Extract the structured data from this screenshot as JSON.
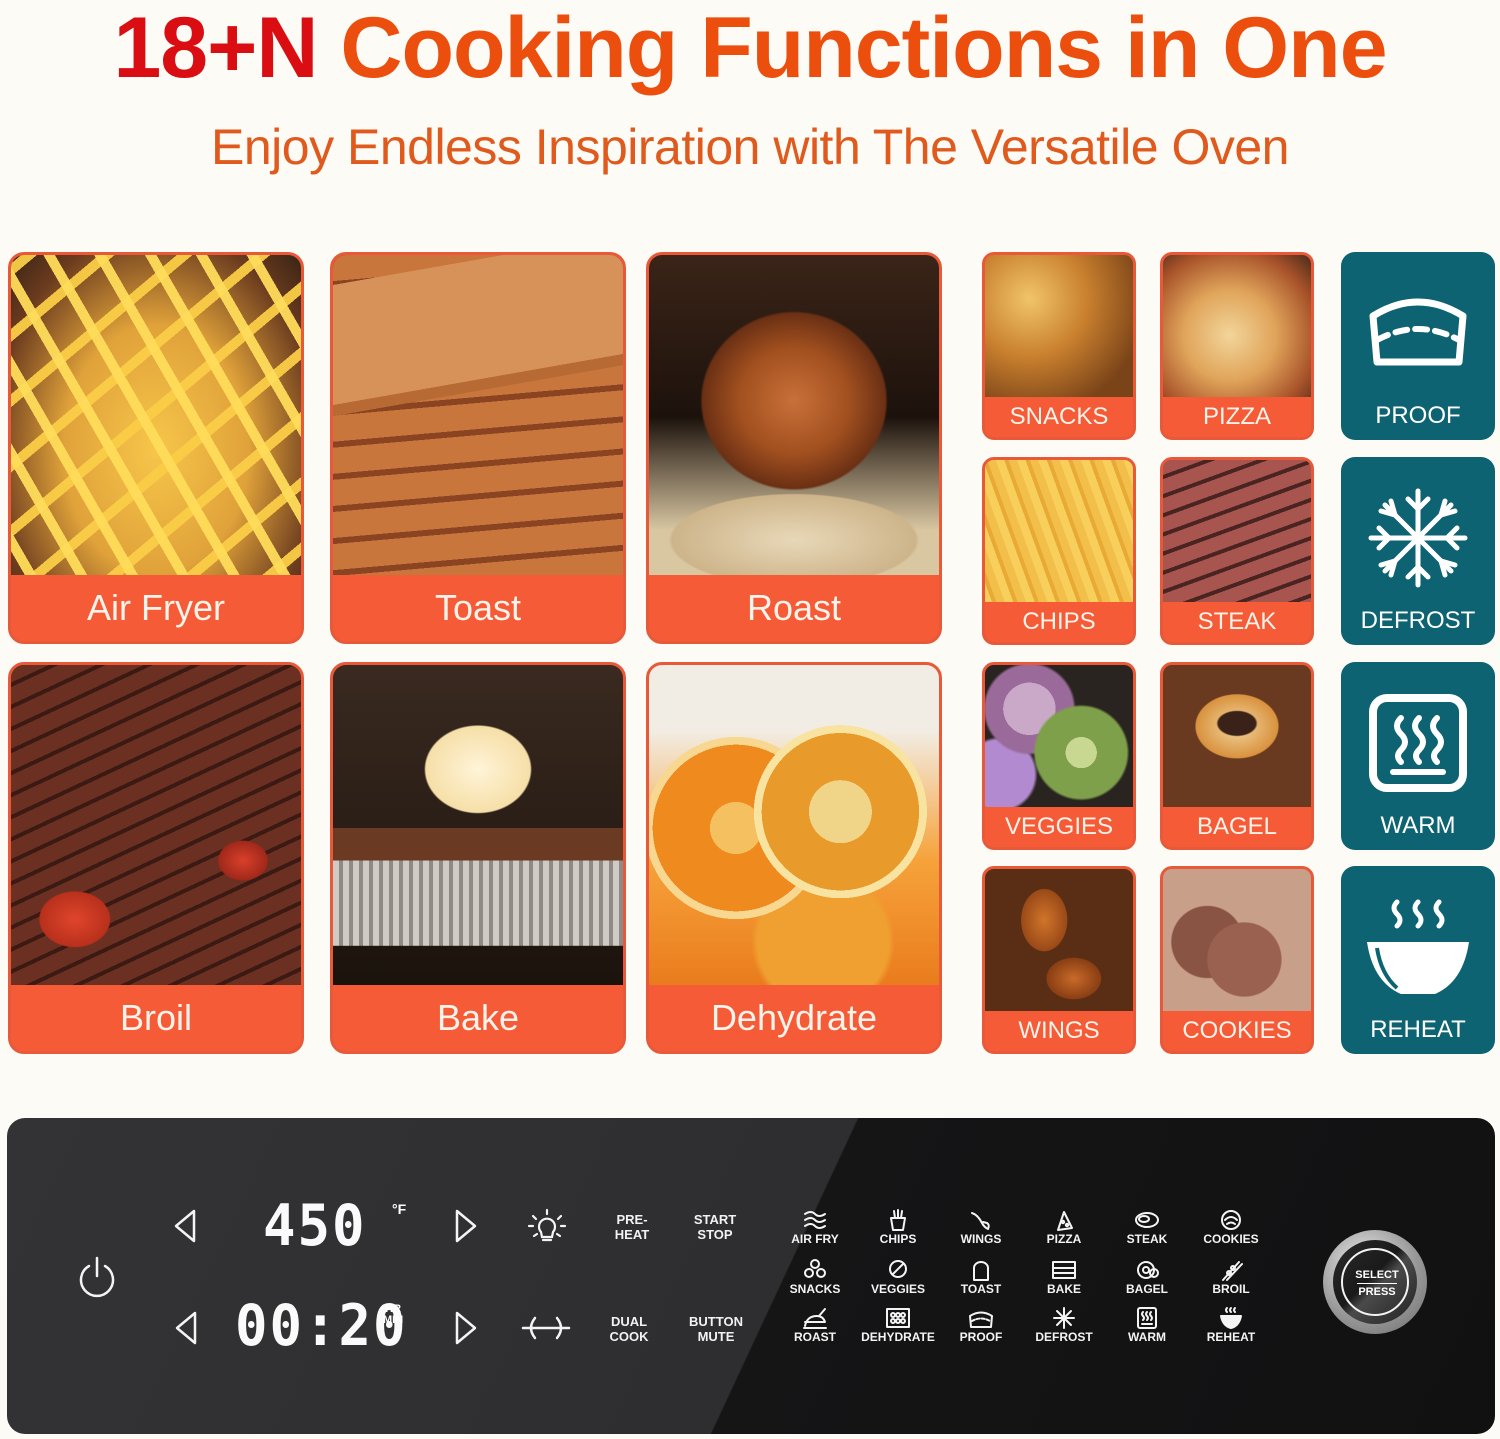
{
  "header": {
    "headline_accent": "18+N",
    "headline_main": "Cooking Functions in One",
    "subheadline": "Enjoy Endless Inspiration with The Versatile Oven"
  },
  "colors": {
    "headline_accent": "#d90d12",
    "headline_main": "#ec4e0e",
    "card_label_bg": "#f45b36",
    "teal_card_bg": "#0d6372",
    "panel_bg": "#2e2e30"
  },
  "big_cards": [
    {
      "label": "Air Fryer",
      "image": "french-fries-photo"
    },
    {
      "label": "Toast",
      "image": "toast-stack-photo"
    },
    {
      "label": "Roast",
      "image": "roast-chicken-photo"
    },
    {
      "label": "Broil",
      "image": "grilled-steak-photo"
    },
    {
      "label": "Bake",
      "image": "cupcake-photo"
    },
    {
      "label": "Dehydrate",
      "image": "dried-orange-slices-photo"
    }
  ],
  "small_cards": [
    {
      "label": "SNACKS",
      "image": "fried-chicken-photo"
    },
    {
      "label": "PIZZA",
      "image": "pizza-slice-photo"
    },
    {
      "label": "CHIPS",
      "image": "chips-photo"
    },
    {
      "label": "STEAK",
      "image": "sliced-steak-photo"
    },
    {
      "label": "VEGGIES",
      "image": "cabbage-photo"
    },
    {
      "label": "BAGEL",
      "image": "sesame-bagel-photo"
    },
    {
      "label": "WINGS",
      "image": "chicken-wings-photo"
    },
    {
      "label": "COOKIES",
      "image": "chocolate-cookies-photo"
    }
  ],
  "teal_cards": [
    {
      "label": "PROOF",
      "icon": "proof-bread-icon"
    },
    {
      "label": "DEFROST",
      "icon": "snowflake-icon"
    },
    {
      "label": "WARM",
      "icon": "warm-heat-icon"
    },
    {
      "label": "REHEAT",
      "icon": "steaming-bowl-icon"
    }
  ],
  "panel": {
    "temperature": "450",
    "temperature_unit": "°F",
    "time": "00:20",
    "time_unit_top": "HR",
    "time_unit_bottom": "MIN",
    "preheat_label": [
      "PRE-",
      "HEAT"
    ],
    "start_stop_label": [
      "START",
      "STOP"
    ],
    "dual_cook_label": [
      "DUAL",
      "COOK"
    ],
    "button_mute_label": [
      "BUTTON",
      "MUTE"
    ],
    "knob_top": "SELECT",
    "knob_bottom": "PRESS",
    "functions": [
      {
        "label": "AIR FRY",
        "icon": "air-fry-icon"
      },
      {
        "label": "CHIPS",
        "icon": "chips-icon"
      },
      {
        "label": "WINGS",
        "icon": "wings-icon"
      },
      {
        "label": "PIZZA",
        "icon": "pizza-icon"
      },
      {
        "label": "STEAK",
        "icon": "steak-icon"
      },
      {
        "label": "COOKIES",
        "icon": "cookies-icon"
      },
      {
        "label": "SNACKS",
        "icon": "snacks-icon"
      },
      {
        "label": "VEGGIES",
        "icon": "veggies-icon"
      },
      {
        "label": "TOAST",
        "icon": "toast-icon"
      },
      {
        "label": "BAKE",
        "icon": "bake-icon"
      },
      {
        "label": "BAGEL",
        "icon": "bagel-icon"
      },
      {
        "label": "BROIL",
        "icon": "broil-icon"
      },
      {
        "label": "ROAST",
        "icon": "roast-icon"
      },
      {
        "label": "DEHYDRATE",
        "icon": "dehydrate-icon"
      },
      {
        "label": "PROOF",
        "icon": "proof-icon"
      },
      {
        "label": "DEFROST",
        "icon": "defrost-icon"
      },
      {
        "label": "WARM",
        "icon": "warm-icon"
      },
      {
        "label": "REHEAT",
        "icon": "reheat-icon"
      }
    ]
  }
}
